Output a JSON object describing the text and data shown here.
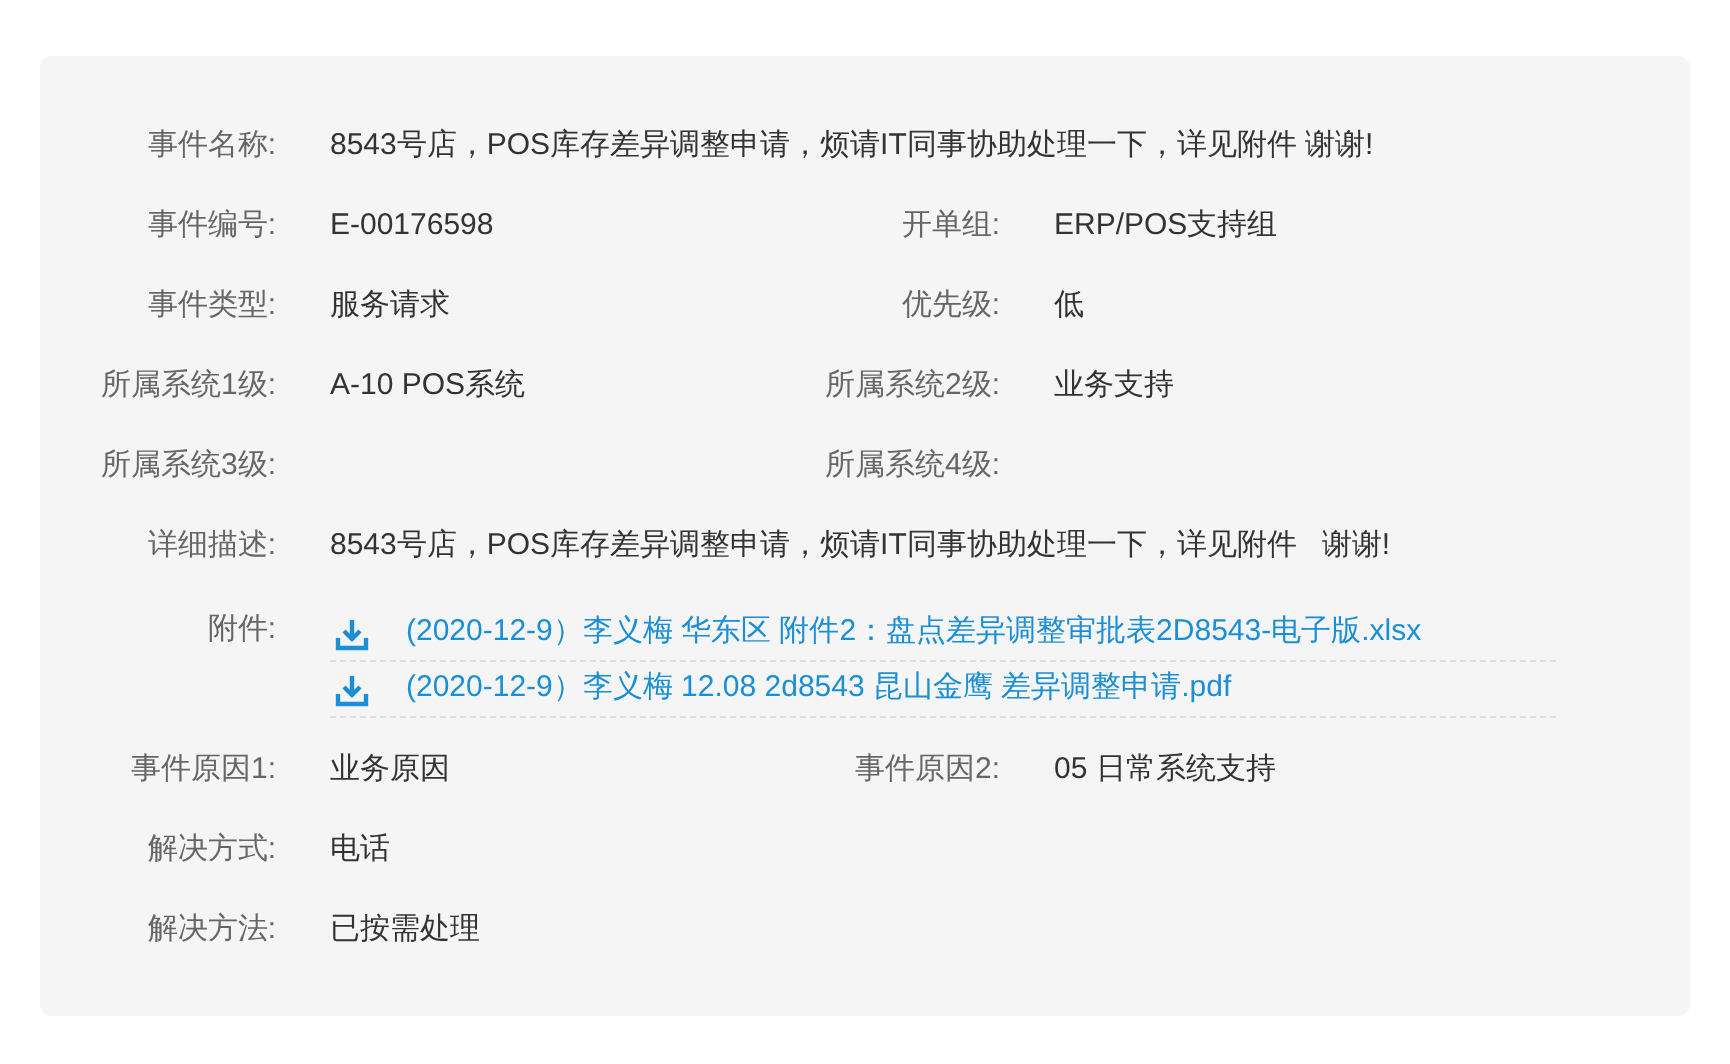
{
  "rows": [
    {
      "kind": "single",
      "label": "事件名称:",
      "value": "8543号店，POS库存差异调整申请，烦请IT同事协助处理一下，详见附件 谢谢!"
    },
    {
      "kind": "pair",
      "label": "事件编号:",
      "value": "E-00176598",
      "label2": "开单组:",
      "value2": "ERP/POS支持组"
    },
    {
      "kind": "pair",
      "label": "事件类型:",
      "value": "服务请求",
      "label2": "优先级:",
      "value2": "低"
    },
    {
      "kind": "pair",
      "label": "所属系统1级:",
      "value": "A-10 POS系统",
      "label2": "所属系统2级:",
      "value2": "业务支持"
    },
    {
      "kind": "pair",
      "label": "所属系统3级:",
      "label2": "所属系统4级:"
    },
    {
      "kind": "single",
      "label": "详细描述:",
      "value": "8543号店，POS库存差异调整申请，烦请IT同事协助处理一下，详见附件   谢谢!"
    },
    {
      "kind": "attachments",
      "label": "附件:",
      "files": [
        "(2020-12-9）李义梅 华东区 附件2：盘点差异调整审批表2D8543-电子版.xlsx",
        "(2020-12-9）李义梅 12.08 2d8543 昆山金鹰 差异调整申请.pdf"
      ]
    },
    {
      "kind": "pair",
      "label": "事件原因1:",
      "value": "业务原因",
      "label2": "事件原因2:",
      "value2": "05 日常系统支持"
    },
    {
      "kind": "single",
      "label": "解决方式:",
      "value": "电话"
    },
    {
      "kind": "single",
      "label": "解决方法:",
      "value": "已按需处理"
    }
  ]
}
